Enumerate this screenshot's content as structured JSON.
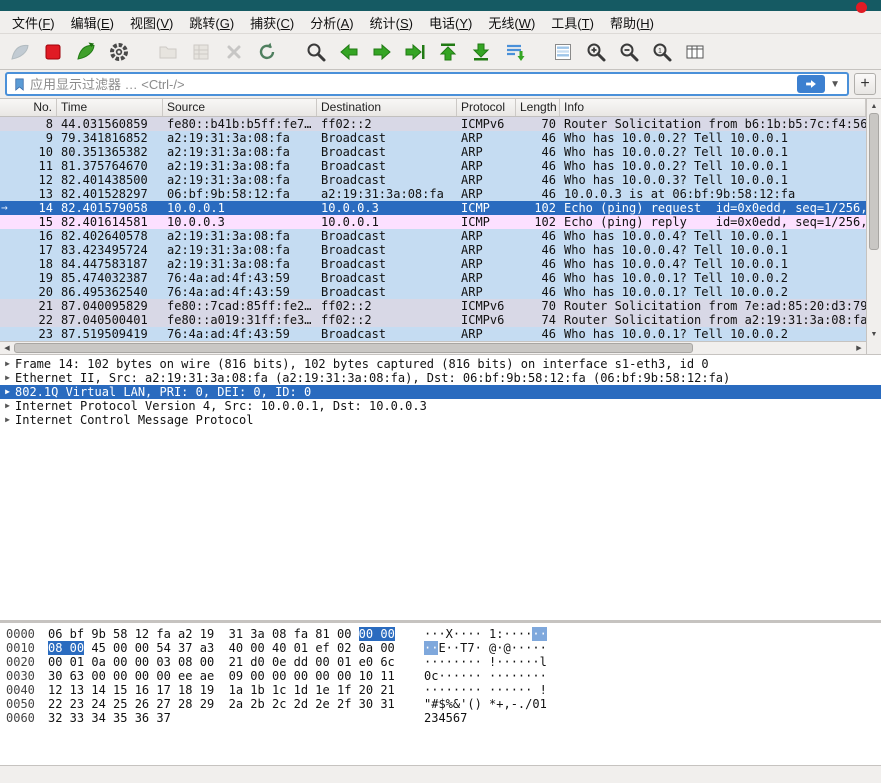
{
  "colors": {
    "selection": "#2a6bbf",
    "selection_light": "#7fa8dc",
    "arp_row": "#c5dcf2",
    "icmp_row": "#fce0ff",
    "icmpv6_row": "#d8d8e6",
    "titlebar": "#155a63",
    "close_red": "#e01b24",
    "accent": "#4a90d9",
    "apply_blue": "#3c80d0"
  },
  "menubar": {
    "items": [
      {
        "name": "file",
        "pre": "文件(",
        "key": "F",
        "post": ")"
      },
      {
        "name": "edit",
        "pre": "编辑(",
        "key": "E",
        "post": ")"
      },
      {
        "name": "view",
        "pre": "视图(",
        "key": "V",
        "post": ")"
      },
      {
        "name": "go",
        "pre": "跳转(",
        "key": "G",
        "post": ")"
      },
      {
        "name": "capture",
        "pre": "捕获(",
        "key": "C",
        "post": ")"
      },
      {
        "name": "analyze",
        "pre": "分析(",
        "key": "A",
        "post": ")"
      },
      {
        "name": "statistics",
        "pre": "统计(",
        "key": "S",
        "post": ")"
      },
      {
        "name": "telephony",
        "pre": "电话(",
        "key": "Y",
        "post": ")"
      },
      {
        "name": "wireless",
        "pre": "无线(",
        "key": "W",
        "post": ")"
      },
      {
        "name": "tools",
        "pre": "工具(",
        "key": "T",
        "post": ")"
      },
      {
        "name": "help",
        "pre": "帮助(",
        "key": "H",
        "post": ")"
      }
    ]
  },
  "toolbar": {
    "buttons": [
      {
        "name": "start-capture",
        "enabled": false
      },
      {
        "name": "stop-capture",
        "enabled": true
      },
      {
        "name": "restart-capture",
        "enabled": true
      },
      {
        "name": "capture-options",
        "enabled": true
      },
      {
        "name": "open-file",
        "enabled": false
      },
      {
        "name": "save-file",
        "enabled": false
      },
      {
        "name": "close-file",
        "enabled": false
      },
      {
        "name": "reload-file",
        "enabled": true
      },
      {
        "name": "find-packet",
        "enabled": true
      },
      {
        "name": "go-back",
        "enabled": true
      },
      {
        "name": "go-forward",
        "enabled": true
      },
      {
        "name": "go-to-packet",
        "enabled": true
      },
      {
        "name": "go-first",
        "enabled": true
      },
      {
        "name": "go-last",
        "enabled": true
      },
      {
        "name": "auto-scroll",
        "enabled": true
      },
      {
        "name": "colorize",
        "enabled": true
      },
      {
        "name": "zoom-in",
        "enabled": true
      },
      {
        "name": "zoom-out",
        "enabled": true
      },
      {
        "name": "zoom-original",
        "enabled": true
      },
      {
        "name": "resize-columns",
        "enabled": true
      }
    ]
  },
  "filter": {
    "placeholder": "应用显示过滤器 … <Ctrl-/>"
  },
  "packet_list": {
    "columns": [
      {
        "id": "no",
        "label": "No."
      },
      {
        "id": "time",
        "label": "Time"
      },
      {
        "id": "source",
        "label": "Source"
      },
      {
        "id": "destination",
        "label": "Destination"
      },
      {
        "id": "protocol",
        "label": "Protocol"
      },
      {
        "id": "length",
        "label": "Length"
      },
      {
        "id": "info",
        "label": "Info"
      }
    ],
    "rows": [
      {
        "no": "8",
        "time": "44.031560859",
        "source": "fe80::b41b:b5ff:fe7…",
        "destination": "ff02::2",
        "protocol": "ICMPv6",
        "length": "70",
        "info": "Router Solicitation from b6:1b:b5:7c:f4:56",
        "color": "icmpv6",
        "selected": false,
        "mark": ""
      },
      {
        "no": "9",
        "time": "79.341816852",
        "source": "a2:19:31:3a:08:fa",
        "destination": "Broadcast",
        "protocol": "ARP",
        "length": "46",
        "info": "Who has 10.0.0.2? Tell 10.0.0.1",
        "color": "arp",
        "selected": false,
        "mark": ""
      },
      {
        "no": "10",
        "time": "80.351365382",
        "source": "a2:19:31:3a:08:fa",
        "destination": "Broadcast",
        "protocol": "ARP",
        "length": "46",
        "info": "Who has 10.0.0.2? Tell 10.0.0.1",
        "color": "arp",
        "selected": false,
        "mark": ""
      },
      {
        "no": "11",
        "time": "81.375764670",
        "source": "a2:19:31:3a:08:fa",
        "destination": "Broadcast",
        "protocol": "ARP",
        "length": "46",
        "info": "Who has 10.0.0.2? Tell 10.0.0.1",
        "color": "arp",
        "selected": false,
        "mark": ""
      },
      {
        "no": "12",
        "time": "82.401438500",
        "source": "a2:19:31:3a:08:fa",
        "destination": "Broadcast",
        "protocol": "ARP",
        "length": "46",
        "info": "Who has 10.0.0.3? Tell 10.0.0.1",
        "color": "arp",
        "selected": false,
        "mark": ""
      },
      {
        "no": "13",
        "time": "82.401528297",
        "source": "06:bf:9b:58:12:fa",
        "destination": "a2:19:31:3a:08:fa",
        "protocol": "ARP",
        "length": "46",
        "info": "10.0.0.3 is at 06:bf:9b:58:12:fa",
        "color": "arp",
        "selected": false,
        "mark": ""
      },
      {
        "no": "14",
        "time": "82.401579058",
        "source": "10.0.0.1",
        "destination": "10.0.0.3",
        "protocol": "ICMP",
        "length": "102",
        "info": "Echo (ping) request  id=0x0edd, seq=1/256,",
        "color": "icmp",
        "selected": true,
        "mark": "→"
      },
      {
        "no": "15",
        "time": "82.401614581",
        "source": "10.0.0.3",
        "destination": "10.0.0.1",
        "protocol": "ICMP",
        "length": "102",
        "info": "Echo (ping) reply    id=0x0edd, seq=1/256,",
        "color": "icmp",
        "selected": false,
        "mark": ""
      },
      {
        "no": "16",
        "time": "82.402640578",
        "source": "a2:19:31:3a:08:fa",
        "destination": "Broadcast",
        "protocol": "ARP",
        "length": "46",
        "info": "Who has 10.0.0.4? Tell 10.0.0.1",
        "color": "arp",
        "selected": false,
        "mark": ""
      },
      {
        "no": "17",
        "time": "83.423495724",
        "source": "a2:19:31:3a:08:fa",
        "destination": "Broadcast",
        "protocol": "ARP",
        "length": "46",
        "info": "Who has 10.0.0.4? Tell 10.0.0.1",
        "color": "arp",
        "selected": false,
        "mark": ""
      },
      {
        "no": "18",
        "time": "84.447583187",
        "source": "a2:19:31:3a:08:fa",
        "destination": "Broadcast",
        "protocol": "ARP",
        "length": "46",
        "info": "Who has 10.0.0.4? Tell 10.0.0.1",
        "color": "arp",
        "selected": false,
        "mark": ""
      },
      {
        "no": "19",
        "time": "85.474032387",
        "source": "76:4a:ad:4f:43:59",
        "destination": "Broadcast",
        "protocol": "ARP",
        "length": "46",
        "info": "Who has 10.0.0.1? Tell 10.0.0.2",
        "color": "arp",
        "selected": false,
        "mark": ""
      },
      {
        "no": "20",
        "time": "86.495362540",
        "source": "76:4a:ad:4f:43:59",
        "destination": "Broadcast",
        "protocol": "ARP",
        "length": "46",
        "info": "Who has 10.0.0.1? Tell 10.0.0.2",
        "color": "arp",
        "selected": false,
        "mark": ""
      },
      {
        "no": "21",
        "time": "87.040095829",
        "source": "fe80::7cad:85ff:fe2…",
        "destination": "ff02::2",
        "protocol": "ICMPv6",
        "length": "70",
        "info": "Router Solicitation from 7e:ad:85:20:d3:79",
        "color": "icmpv6",
        "selected": false,
        "mark": ""
      },
      {
        "no": "22",
        "time": "87.040500401",
        "source": "fe80::a019:31ff:fe3…",
        "destination": "ff02::2",
        "protocol": "ICMPv6",
        "length": "74",
        "info": "Router Solicitation from a2:19:31:3a:08:fa",
        "color": "icmpv6",
        "selected": false,
        "mark": ""
      },
      {
        "no": "23",
        "time": "87.519509419",
        "source": "76:4a:ad:4f:43:59",
        "destination": "Broadcast",
        "protocol": "ARP",
        "length": "46",
        "info": "Who has 10.0.0.1? Tell 10.0.0.2",
        "color": "arp",
        "selected": false,
        "mark": ""
      }
    ]
  },
  "details": {
    "rows": [
      {
        "text": "Frame 14: 102 bytes on wire (816 bits), 102 bytes captured (816 bits) on interface s1-eth3, id 0",
        "selected": false
      },
      {
        "text": "Ethernet II, Src: a2:19:31:3a:08:fa (a2:19:31:3a:08:fa), Dst: 06:bf:9b:58:12:fa (06:bf:9b:58:12:fa)",
        "selected": false
      },
      {
        "text": "802.1Q Virtual LAN, PRI: 0, DEI: 0, ID: 0",
        "selected": true
      },
      {
        "text": "Internet Protocol Version 4, Src: 10.0.0.1, Dst: 10.0.0.3",
        "selected": false
      },
      {
        "text": "Internet Control Message Protocol",
        "selected": false
      }
    ]
  },
  "hex": {
    "lines": [
      {
        "offset": "0000",
        "hex": [
          [
            "06 bf 9b 58 12 fa a2 19  31 3a 08 fa 81 00 ",
            0
          ],
          [
            "00 00",
            1
          ]
        ],
        "ascii": [
          [
            "···X···· 1:····",
            0
          ],
          [
            "··",
            1
          ]
        ]
      },
      {
        "offset": "0010",
        "hex": [
          [
            "08 00",
            1
          ],
          [
            " 45 00 00 54 37 a3  40 00 40 01 ef 02 0a 00",
            0
          ]
        ],
        "ascii": [
          [
            "··",
            1
          ],
          [
            "E··T7· @·@·····",
            0
          ]
        ]
      },
      {
        "offset": "0020",
        "hex": [
          [
            "00 01 0a 00 00 03 08 00  21 d0 0e dd 00 01 e0 6c",
            0
          ]
        ],
        "ascii": [
          [
            "········ !······l",
            0
          ]
        ]
      },
      {
        "offset": "0030",
        "hex": [
          [
            "30 63 00 00 00 00 ee ae  09 00 00 00 00 00 10 11",
            0
          ]
        ],
        "ascii": [
          [
            "0c······ ········",
            0
          ]
        ]
      },
      {
        "offset": "0040",
        "hex": [
          [
            "12 13 14 15 16 17 18 19  1a 1b 1c 1d 1e 1f 20 21",
            0
          ]
        ],
        "ascii": [
          [
            "········ ······ !",
            0
          ]
        ]
      },
      {
        "offset": "0050",
        "hex": [
          [
            "22 23 24 25 26 27 28 29  2a 2b 2c 2d 2e 2f 30 31",
            0
          ]
        ],
        "ascii": [
          [
            "\"#$%&'() *+,-./01",
            0
          ]
        ]
      },
      {
        "offset": "0060",
        "hex": [
          [
            "32 33 34 35 36 37",
            0
          ]
        ],
        "ascii": [
          [
            "234567",
            0
          ]
        ]
      }
    ]
  }
}
